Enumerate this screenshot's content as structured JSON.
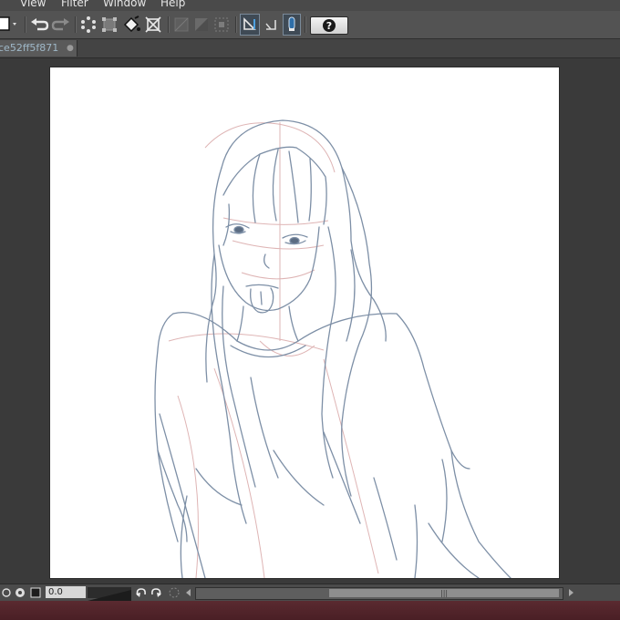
{
  "menu": {
    "items": [
      "View",
      "Filter",
      "Window",
      "Help"
    ]
  },
  "toolbar": {
    "help_label": "?"
  },
  "tabs": {
    "document_name": "ce52ff5f871",
    "close_symbol": "●"
  },
  "status": {
    "rotation_value": "0.0",
    "scroll_grip": "|||"
  },
  "icons": {
    "undo": "undo-icon",
    "redo": "redo-icon",
    "help": "help-icon",
    "close": "close-icon"
  },
  "colors": {
    "ui_dark": "#3c3c3c",
    "toolbar": "#535353",
    "tab_text": "#9fb8c8",
    "accent_blue": "#2e6ea8",
    "sketch_blue": "#7a8ea6",
    "sketch_red": "#d9a0a0"
  }
}
